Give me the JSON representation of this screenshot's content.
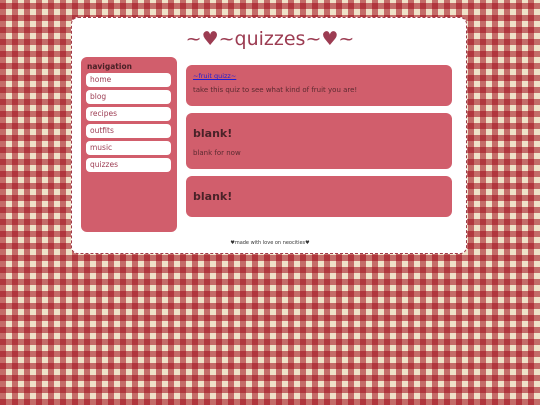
{
  "site": {
    "title": "~♥~quizzes~♥~"
  },
  "sidebar": {
    "heading": "navigation",
    "items": [
      {
        "label": "home"
      },
      {
        "label": "blog"
      },
      {
        "label": "recipes"
      },
      {
        "label": "outfits"
      },
      {
        "label": "music"
      },
      {
        "label": "quizzes"
      }
    ]
  },
  "main": {
    "cards": [
      {
        "link": "~fruit quizz~",
        "text": "take this quiz to see what kind of fruit you are!"
      },
      {
        "title": "blank!",
        "text": "blank for now"
      },
      {
        "title": "blank!"
      }
    ]
  },
  "footer": {
    "text": "♥made with love on neocities♥"
  },
  "colors": {
    "accent": "#d15e6c",
    "title": "#9c3c52",
    "link": "#1f1cd4",
    "background_check": "#a00a19"
  }
}
